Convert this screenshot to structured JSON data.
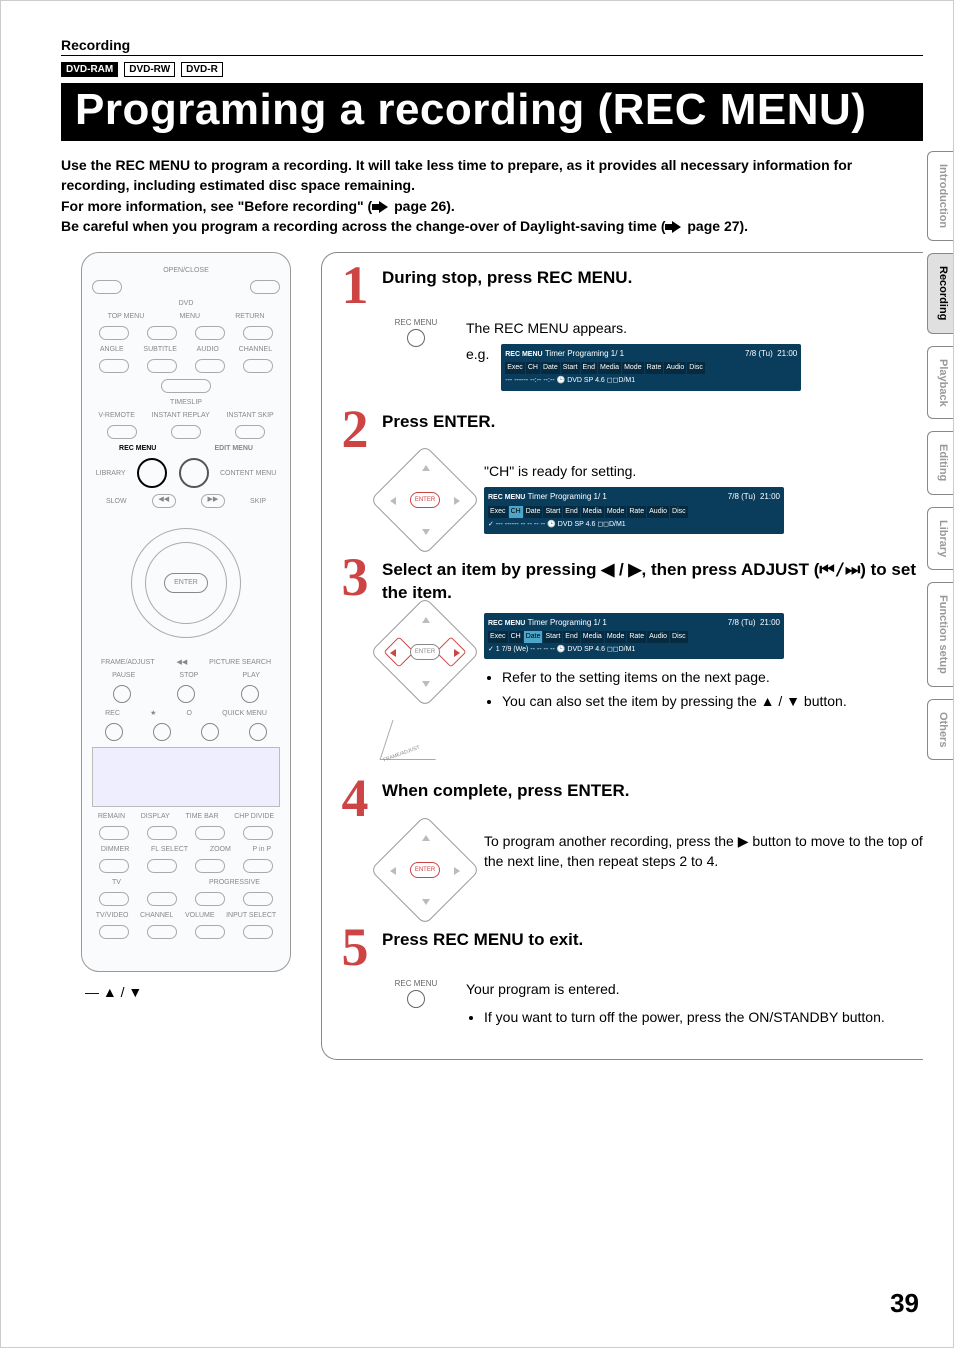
{
  "header": {
    "section": "Recording",
    "badges": [
      "DVD-RAM",
      "DVD-RW",
      "DVD-R"
    ],
    "title": "Programing a recording (REC MENU)"
  },
  "intro": {
    "p1": "Use the REC MENU to program a recording. It will take less time to prepare, as it provides all necessary information for recording, including estimated disc space remaining.",
    "p2a": "For more information, see \"Before recording\" (",
    "p2b": " page 26).",
    "p3a": "Be careful when you program a recording across the change-over of Daylight-saving time (",
    "p3b": " page 27)."
  },
  "remote": {
    "rows": {
      "open_close": "OPEN/CLOSE",
      "dvd": "DVD",
      "topmenu": "TOP MENU",
      "menu": "MENU",
      "return": "RETURN",
      "angle": "ANGLE",
      "subtitle": "SUBTITLE",
      "audio": "AUDIO",
      "channel": "CHANNEL",
      "timeslip": "TIMESLIP",
      "vremote": "V-REMOTE",
      "instant_replay": "INSTANT REPLAY",
      "instant_skip": "INSTANT SKIP",
      "recmenu": "REC MENU",
      "editmenu": "EDIT MENU",
      "library": "LIBRARY",
      "contentmenu": "CONTENT MENU",
      "slow": "SLOW",
      "skip": "SKIP",
      "enter": "ENTER",
      "frame_adjust": "FRAME/ADJUST",
      "picture_search": "PICTURE SEARCH",
      "pause": "PAUSE",
      "stop": "STOP",
      "play": "PLAY",
      "rec": "REC",
      "star": "★",
      "o": "O",
      "quickmenu": "QUICK MENU",
      "remain": "REMAIN",
      "display": "DISPLAY",
      "timebar": "TIME BAR",
      "chpdivide": "CHP DIVIDE",
      "dimmer": "DIMMER",
      "flselect": "FL SELECT",
      "zoom": "ZOOM",
      "pinp": "P in P",
      "tv": "TV",
      "progressive": "PROGRESSIVE",
      "tvvideo": "TV/VIDEO",
      "channel2": "CHANNEL",
      "volume": "VOLUME",
      "inputselect": "INPUT SELECT"
    },
    "footnote": "▲ / ▼"
  },
  "steps": [
    {
      "num": "1",
      "title": "During stop, press REC MENU.",
      "control_label": "REC MENU",
      "desc": "The REC MENU appears.",
      "eg": "e.g.",
      "osd_title": "Timer Programing  1/ 1",
      "osd_date": "7/8 (Tu)",
      "osd_time": "21:00",
      "osd_cols": [
        "Exec",
        "CH",
        "Date",
        "Start",
        "End",
        "Media",
        "Mode",
        "Rate",
        "Audio",
        "Disc"
      ],
      "osd_row": "---   ------   --:--   --:--   🕒 DVD   SP   4.6  ◻◻D/M1",
      "osd_icon": "REC MENU"
    },
    {
      "num": "2",
      "title": "Press ENTER.",
      "control_label": "ENTER",
      "desc": "\"CH\" is ready for setting.",
      "osd_title": "Timer Programing  1/ 1",
      "osd_date": "7/8 (Tu)",
      "osd_time": "21:00",
      "osd_cols": [
        "Exec",
        "CH",
        "Date",
        "Start",
        "End",
        "Media",
        "Mode",
        "Rate",
        "Audio",
        "Disc"
      ],
      "osd_row": "✓   ---   ------   -- --   -- --   🕒 DVD   SP   4.6  ◻◻D/M1",
      "osd_hl_col": "CH",
      "osd_icon": "REC MENU"
    },
    {
      "num": "3",
      "title_a": "Select an item by pressing ◀ / ▶, then press ADJUST (",
      "title_b": ") to set the item.",
      "adjust_glyph": "⏮/⏭",
      "osd_title": "Timer Programing  1/ 1",
      "osd_date": "7/8 (Tu)",
      "osd_time": "21:00",
      "osd_cols": [
        "Exec",
        "CH",
        "Date",
        "Start",
        "End",
        "Media",
        "Mode",
        "Rate",
        "Audio",
        "Disc"
      ],
      "osd_row": "✓   1   7/9 (We)   -- --   -- --   🕒 DVD   SP   4.6  ◻◻D/M1",
      "osd_hl_col": "Date",
      "osd_icon": "REC MENU",
      "bullets": [
        "Refer to the setting items on the next page.",
        "You can also set the item by pressing the ▲ / ▼ button."
      ]
    },
    {
      "num": "4",
      "title": "When complete, press ENTER.",
      "control_label": "ENTER",
      "desc": "To program another recording, press the ▶ button to move to the top of the next line, then repeat steps 2 to 4."
    },
    {
      "num": "5",
      "title": "Press REC MENU to exit.",
      "control_label": "REC MENU",
      "desc": "Your program is entered.",
      "bullets": [
        "If you want to turn off the power, press the ON/STANDBY button."
      ]
    }
  ],
  "side_tabs": [
    {
      "label": "Introduction",
      "active": false
    },
    {
      "label": "Recording",
      "active": true
    },
    {
      "label": "Playback",
      "active": false
    },
    {
      "label": "Editing",
      "active": false
    },
    {
      "label": "Library",
      "active": false
    },
    {
      "label": "Function setup",
      "active": false
    },
    {
      "label": "Others",
      "active": false
    }
  ],
  "page_number": "39"
}
